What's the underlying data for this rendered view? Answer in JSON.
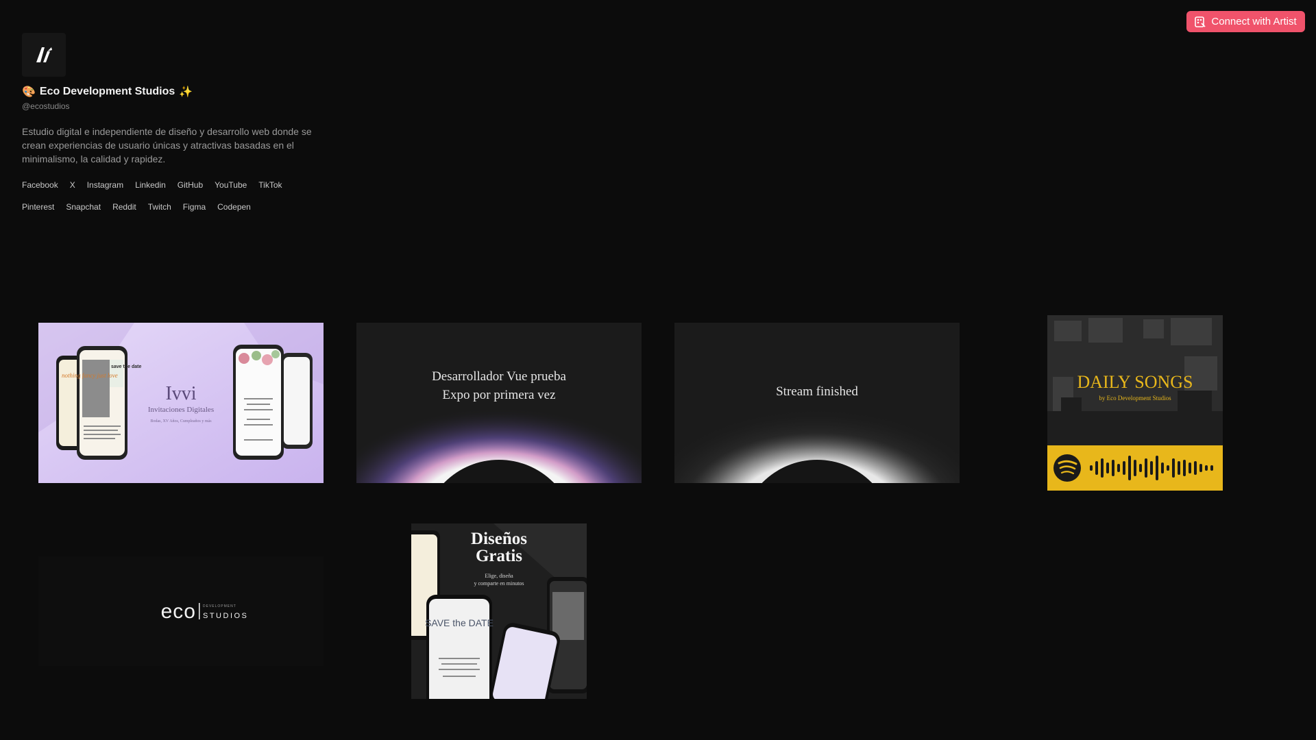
{
  "header": {
    "connect_label": "Connect with Artist"
  },
  "profile": {
    "name_prefix_emoji": "🎨",
    "name": "Eco Development Studios",
    "name_suffix_emoji": "✨",
    "handle": "@ecostudios",
    "bio": "Estudio digital e independiente de diseño y desarrollo web donde se crean experiencias de usuario únicas y atractivas basadas en el minimalismo, la calidad y rapidez.",
    "socials": [
      "Facebook",
      "X",
      "Instagram",
      "Linkedin",
      "GitHub",
      "YouTube",
      "TikTok",
      "Pinterest",
      "Snapchat",
      "Reddit",
      "Twitch",
      "Figma",
      "Codepen"
    ]
  },
  "cards": {
    "ivvi": {
      "title": "Ivvi",
      "subtitle": "Invitaciones Digitales",
      "tagline": "Bodas, XV Años, Cumpleaños y más",
      "phone_text_1": "nothing fancy just love",
      "phone_text_2": "save the date"
    },
    "vue": {
      "line1": "Desarrollador Vue prueba",
      "line2": "Expo por primera vez"
    },
    "stream": {
      "text": "Stream finished"
    },
    "daily": {
      "title": "DAILY SONGS",
      "subtitle": "by Eco Development Studios"
    },
    "eco": {
      "brand": "eco",
      "sub_top": "DEVELOPMENT",
      "sub_bottom": "STUDIOS"
    },
    "disenos": {
      "title_line1": "Diseños",
      "title_line2": "Gratis",
      "subtitle_line1": "Elige, diseña",
      "subtitle_line2": "y comparte en minutos",
      "phone_text": "SAVE the DATE"
    }
  },
  "colors": {
    "background": "#0c0c0c",
    "accent": "#f0536b",
    "spotify_yellow": "#e8b71b",
    "ivvi_lavender": "#d9c8f5"
  }
}
